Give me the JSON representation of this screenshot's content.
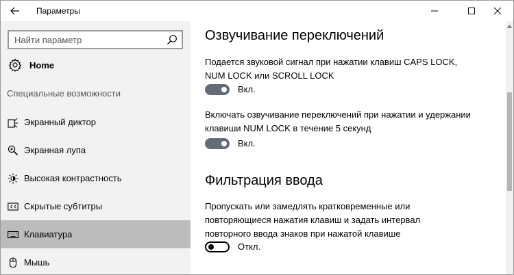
{
  "window": {
    "title": "Параметры",
    "icons": {
      "back": "back-arrow-icon",
      "minimize": "minimize-icon",
      "maximize": "maximize-icon",
      "close": "close-icon"
    }
  },
  "sidebar": {
    "search": {
      "placeholder": "Найти параметр",
      "icon": "search-icon"
    },
    "home": {
      "label": "Home",
      "icon": "gear-icon"
    },
    "section": "Специальные возможности",
    "items": [
      {
        "label": "Экранный диктор",
        "icon": "narrator-icon"
      },
      {
        "label": "Экранная лупа",
        "icon": "magnifier-icon"
      },
      {
        "label": "Высокая контрастность",
        "icon": "contrast-sun-icon"
      },
      {
        "label": "Скрытые субтитры",
        "icon": "closed-captions-icon"
      },
      {
        "label": "Клавиатура",
        "icon": "keyboard-icon",
        "selected": true
      },
      {
        "label": "Мышь",
        "icon": "mouse-icon"
      }
    ]
  },
  "content": {
    "toggle_keys": {
      "heading": "Озвучивание переключений",
      "setting1": {
        "description": "Подается звуковой сигнал при нажатии клавиш CAPS LOCK, NUM LOCK или SCROLL LOCK",
        "state": "Вкл."
      },
      "setting2": {
        "description": "Включать озвучивание переключений при нажатии и удержании клавиши NUM LOCK в течение 5 секунд",
        "state": "Вкл."
      }
    },
    "filter_keys": {
      "heading": "Фильтрация ввода",
      "setting1": {
        "description": "Пропускать или замедлять кратковременные или повторяющиеся нажатия клавиш и задать интервал повторного ввода знаков при нажатой клавише",
        "state": "Откл."
      }
    }
  },
  "colors": {
    "sidebar_bg": "#f2f2f2",
    "selected_bg": "#bcbcbc",
    "toggle_on": "#626c78",
    "scroll_thumb": "#b5b5b5"
  }
}
